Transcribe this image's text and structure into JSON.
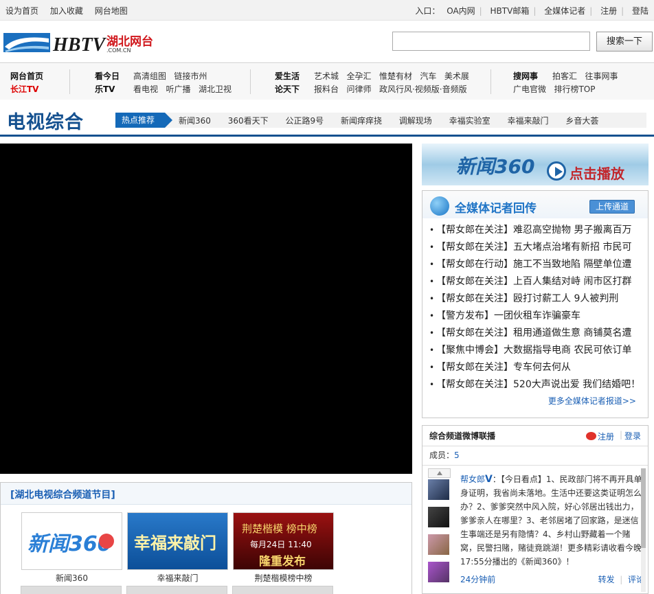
{
  "topbar": {
    "left_links": [
      "设为首页",
      "加入收藏",
      "网台地图"
    ],
    "entry_label": "入口：",
    "right_links": [
      "OA内网",
      "HBTV邮箱",
      "全媒体记者",
      "注册",
      "登陆"
    ]
  },
  "header": {
    "logo_text": "HBTV",
    "logo_sub": "湖北网台",
    "logo_domain": ".COM.CN",
    "search_button": "搜索一下",
    "search_value": ""
  },
  "nav": {
    "home": "网台首页",
    "changjiang": "长江TV",
    "kanjinri": "看今日",
    "letv": "乐TV",
    "g1_row1": [
      "高清组图",
      "链接市州"
    ],
    "g1_row2": [
      "看电视",
      "听广播",
      "湖北卫视"
    ],
    "aishenghuo": "爱生活",
    "luntianxia": "论天下",
    "g2_row1": [
      "艺术城",
      "全孕汇",
      "惟楚有材",
      "汽车",
      "美术展"
    ],
    "g2_row2": [
      "报料台",
      "问律师",
      "政风行风·视频版·音频版"
    ],
    "souwangshi": "搜网事",
    "g3_row1": [
      "拍客汇",
      "往事网事"
    ],
    "g3_row2": [
      "广电官微",
      "排行榜TOP"
    ]
  },
  "channel": {
    "title": "电视综合",
    "hot_tag": "热点推荐",
    "hot_links": [
      "新闻360",
      "360看天下",
      "公正路9号",
      "新闻痒痒挠",
      "调解现场",
      "幸福实验室",
      "幸福来敲门",
      "乡音大荟"
    ]
  },
  "banner360": {
    "title": "新闻360",
    "action": "点击播放"
  },
  "reporter": {
    "title": "全媒体记者回传",
    "upload": "上传通道",
    "items": [
      "【帮女郎在关注】难忍高空抛物 男子搬离百万",
      "【帮女郎在关注】五大堵点治堵有新招 市民可",
      "【帮女郎在行动】施工不当致地陷 隔壁单位遭",
      "【帮女郎在关注】上百人集结对峙 闹市区打群",
      "【帮女郎在关注】殴打讨薪工人 9人被判刑",
      "【警方发布】一团伙租车诈骗豪车",
      "【帮女郎在关注】租用通道做生意 商铺莫名遭",
      "【聚焦中博会】大数据指导电商 农民可依订单",
      "【帮女郎在关注】专车何去何从",
      "【帮女郎在关注】520大声说出爱 我们结婚吧！"
    ],
    "more": "更多全媒体记者报道>>"
  },
  "weibo": {
    "title": "综合频道微博联播",
    "register": "注册",
    "login": "登录",
    "members_label": "成员：",
    "members_count": "5",
    "post_author": "帮女郎",
    "post_v": "V",
    "post_text": "：【今日看点】1、民政部门将不再开具单身证明，我省尚未落地。生活中还要这类证明怎么办？2、爹爹突然中风入院，好心邻居出钱出力，爹爹亲人在哪里？3、老邻居堵了回家路，是迷信生事端还是另有隐情？4、乡村山野藏着一个赌窝，民警扫赌，赌徒竟跳湖！更多精彩请收看今晚17:55分播出的《新闻360》！",
    "post_time": "24分钟前",
    "forward": "转发",
    "comment": "评论"
  },
  "programs": {
    "title": "[湖北电视综合频道节目]",
    "items": [
      {
        "caption": "新闻360",
        "art": "新闻360"
      },
      {
        "caption": "幸福来敲门",
        "art": "幸福来敲门"
      },
      {
        "caption": "荆楚楷模榜中榜",
        "art_l1": "荆楚楷模 榜中榜",
        "art_l2": "每月24日  11:40",
        "art_l3": "隆重发布"
      }
    ]
  }
}
